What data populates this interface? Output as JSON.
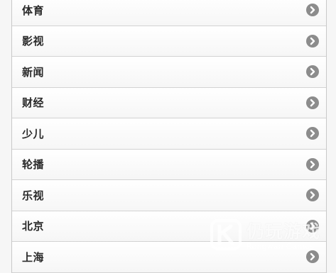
{
  "list": {
    "items": [
      {
        "label": "体育",
        "icon": "chevron-right-circle-icon"
      },
      {
        "label": "影视",
        "icon": "chevron-right-circle-icon"
      },
      {
        "label": "新闻",
        "icon": "chevron-right-circle-icon"
      },
      {
        "label": "财经",
        "icon": "chevron-right-circle-icon"
      },
      {
        "label": "少儿",
        "icon": "chevron-right-circle-icon"
      },
      {
        "label": "轮播",
        "icon": "chevron-right-circle-icon"
      },
      {
        "label": "乐视",
        "icon": "chevron-right-circle-icon"
      },
      {
        "label": "北京",
        "icon": "chevron-right-circle-icon"
      },
      {
        "label": "上海",
        "icon": "chevron-right-circle-icon"
      }
    ]
  },
  "watermark": {
    "title": "仍玩游戏",
    "subtitle": "Rengwan Games",
    "logo_icon": "rengwan-logo-icon"
  },
  "colors": {
    "icon_fill": "#8c8c8c",
    "label_text": "#2a2a2a"
  }
}
